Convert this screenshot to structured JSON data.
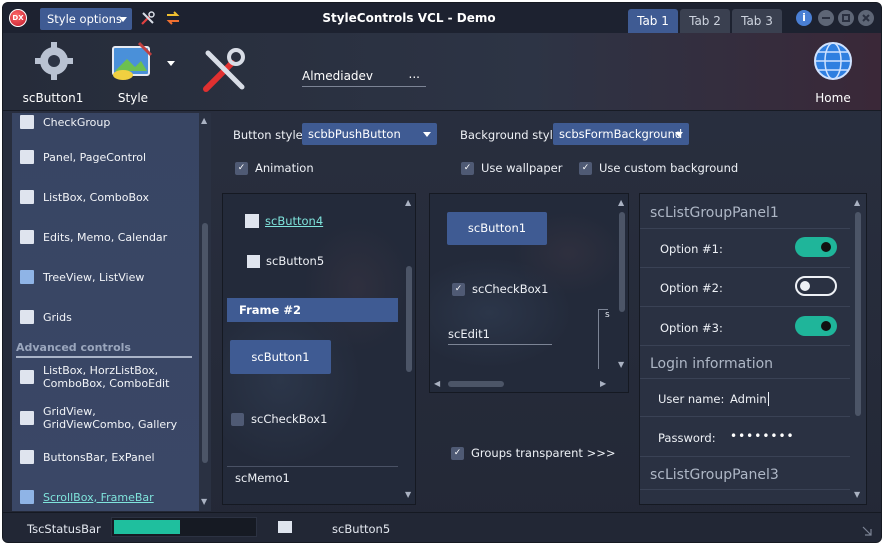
{
  "titlebar": {
    "app_icon": "DX",
    "style_options_label": "Style options",
    "title": "StyleControls VCL - Demo",
    "tabs": [
      {
        "label": "Tab 1",
        "active": true
      },
      {
        "label": "Tab 2",
        "active": false
      },
      {
        "label": "Tab 3",
        "active": false
      }
    ],
    "info_glyph": "i"
  },
  "toolbar": {
    "button1_label": "scButton1",
    "style_label": "Style",
    "home_label": "Home",
    "edit_value": "Almediadev",
    "edit_button": "..."
  },
  "sidebar": {
    "items_top": [
      {
        "label": "CheckGroup",
        "icon": "checkgroup-icon"
      },
      {
        "label": "Panel, PageControl",
        "icon": "panel-icon"
      },
      {
        "label": "ListBox, ComboBox",
        "icon": "listbox-icon"
      },
      {
        "label": "Edits, Memo, Calendar",
        "icon": "edit-icon"
      },
      {
        "label": "TreeView, ListView",
        "icon": "treeview-icon"
      },
      {
        "label": "Grids",
        "icon": "grid-icon"
      }
    ],
    "advanced_header": "Advanced controls",
    "items_advanced": [
      {
        "label": "ListBox, HorzListBox, ComboBox, ComboEdit",
        "icon": "listbox-icon"
      },
      {
        "label": "GridView, GridViewCombo, Gallery",
        "icon": "gridview-icon"
      },
      {
        "label": "ButtonsBar, ExPanel",
        "icon": "buttonsbar-icon"
      },
      {
        "label": "ScrollBox, FrameBar",
        "icon": "scrollbox-icon",
        "selected": true
      }
    ]
  },
  "options": {
    "button_style_label": "Button style:",
    "button_style_value": "scbbPushButton",
    "background_style_label": "Background style:",
    "background_style_value": "scbsFormBackground",
    "animation_label": "Animation",
    "use_wallpaper_label": "Use wallpaper",
    "use_custom_bg_label": "Use custom background"
  },
  "framebar": {
    "link_button4": "scButton4",
    "link_button5": "scButton5",
    "frame2_label": "Frame #2",
    "button1": "scButton1",
    "checkbox1": "scCheckBox1",
    "memo1": "scMemo1"
  },
  "scrollbox": {
    "button1": "scButton1",
    "checkbox1": "scCheckBox1",
    "edit1": "scEdit1",
    "clipped": "s"
  },
  "groups_transparent_label": "Groups transparent >>>",
  "listgroup": {
    "panel1_header": "scListGroupPanel1",
    "options": [
      {
        "label": "Option #1:",
        "on": true
      },
      {
        "label": "Option #2:",
        "on": false
      },
      {
        "label": "Option #3:",
        "on": true
      }
    ],
    "login_header": "Login information",
    "username_label": "User name:",
    "username_value": "Admin",
    "password_label": "Password:",
    "password_value": "••••••••",
    "panel3_header": "scListGroupPanel3"
  },
  "statusbar": {
    "label": "TscStatusBar",
    "progress_fraction": 0.47,
    "button5": "scButton5"
  },
  "colors": {
    "accent": "#3f5b93",
    "toggle_on": "#1fb59a",
    "link": "#7fe4dc"
  }
}
